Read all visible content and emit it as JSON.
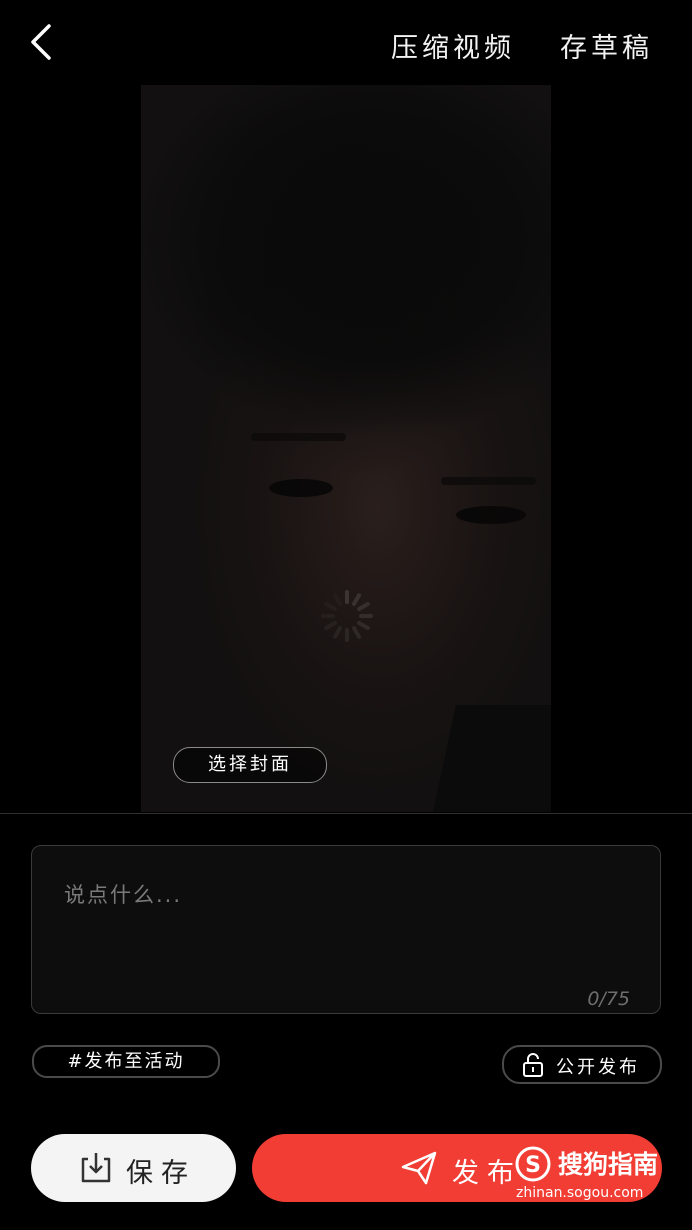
{
  "header": {
    "compress_label": "压缩视频",
    "draft_label": "存草稿"
  },
  "preview": {
    "cover_button_label": "选择封面"
  },
  "caption": {
    "placeholder": "说点什么...",
    "counter": "0/75"
  },
  "options": {
    "activity_tag_label": "#发布至活动",
    "visibility_label": "公开发布"
  },
  "actions": {
    "save_label": "保存",
    "publish_label": "发布"
  },
  "watermark": {
    "brand": "搜狗指南",
    "url": "zhinan.sogou.com"
  },
  "colors": {
    "background": "#000000",
    "publish_accent": "#f13d34",
    "save_bg": "#f4f4f4"
  },
  "icons": [
    "back-chevron-icon",
    "loading-spinner-icon",
    "unlock-icon",
    "download-icon",
    "send-icon",
    "sogou-logo-icon"
  ]
}
